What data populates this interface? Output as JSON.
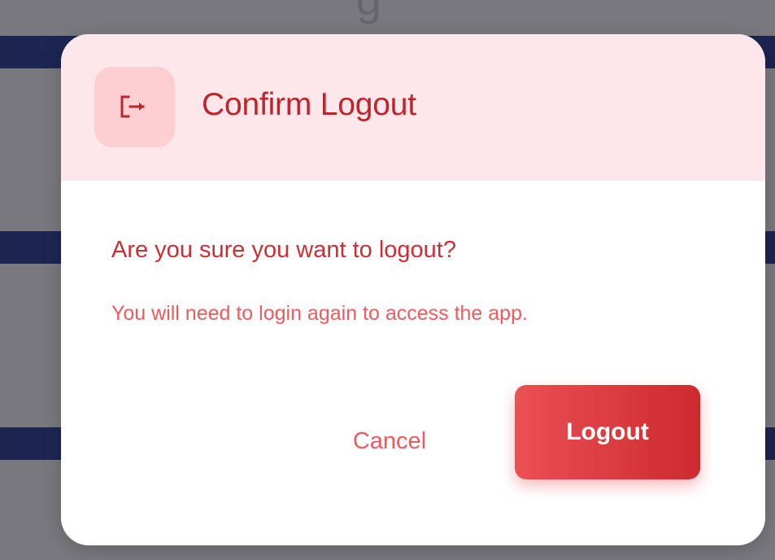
{
  "background": {
    "title_fragment": "g"
  },
  "dialog": {
    "icon": "logout-icon",
    "title": "Confirm Logout",
    "question": "Are you sure you want to logout?",
    "subtext": "You will need to login again to access the app.",
    "cancel_label": "Cancel",
    "confirm_label": "Logout"
  },
  "colors": {
    "header_background": "#fde7ea",
    "icon_box": "#fccfd3",
    "title": "#c0242b",
    "question": "#c93036",
    "subtext": "#ef5a5e",
    "confirm_gradient_start": "#ea5054",
    "confirm_gradient_end": "#cc2a2e",
    "overlay": "#6e6c72",
    "app_band": "#1c2550"
  }
}
